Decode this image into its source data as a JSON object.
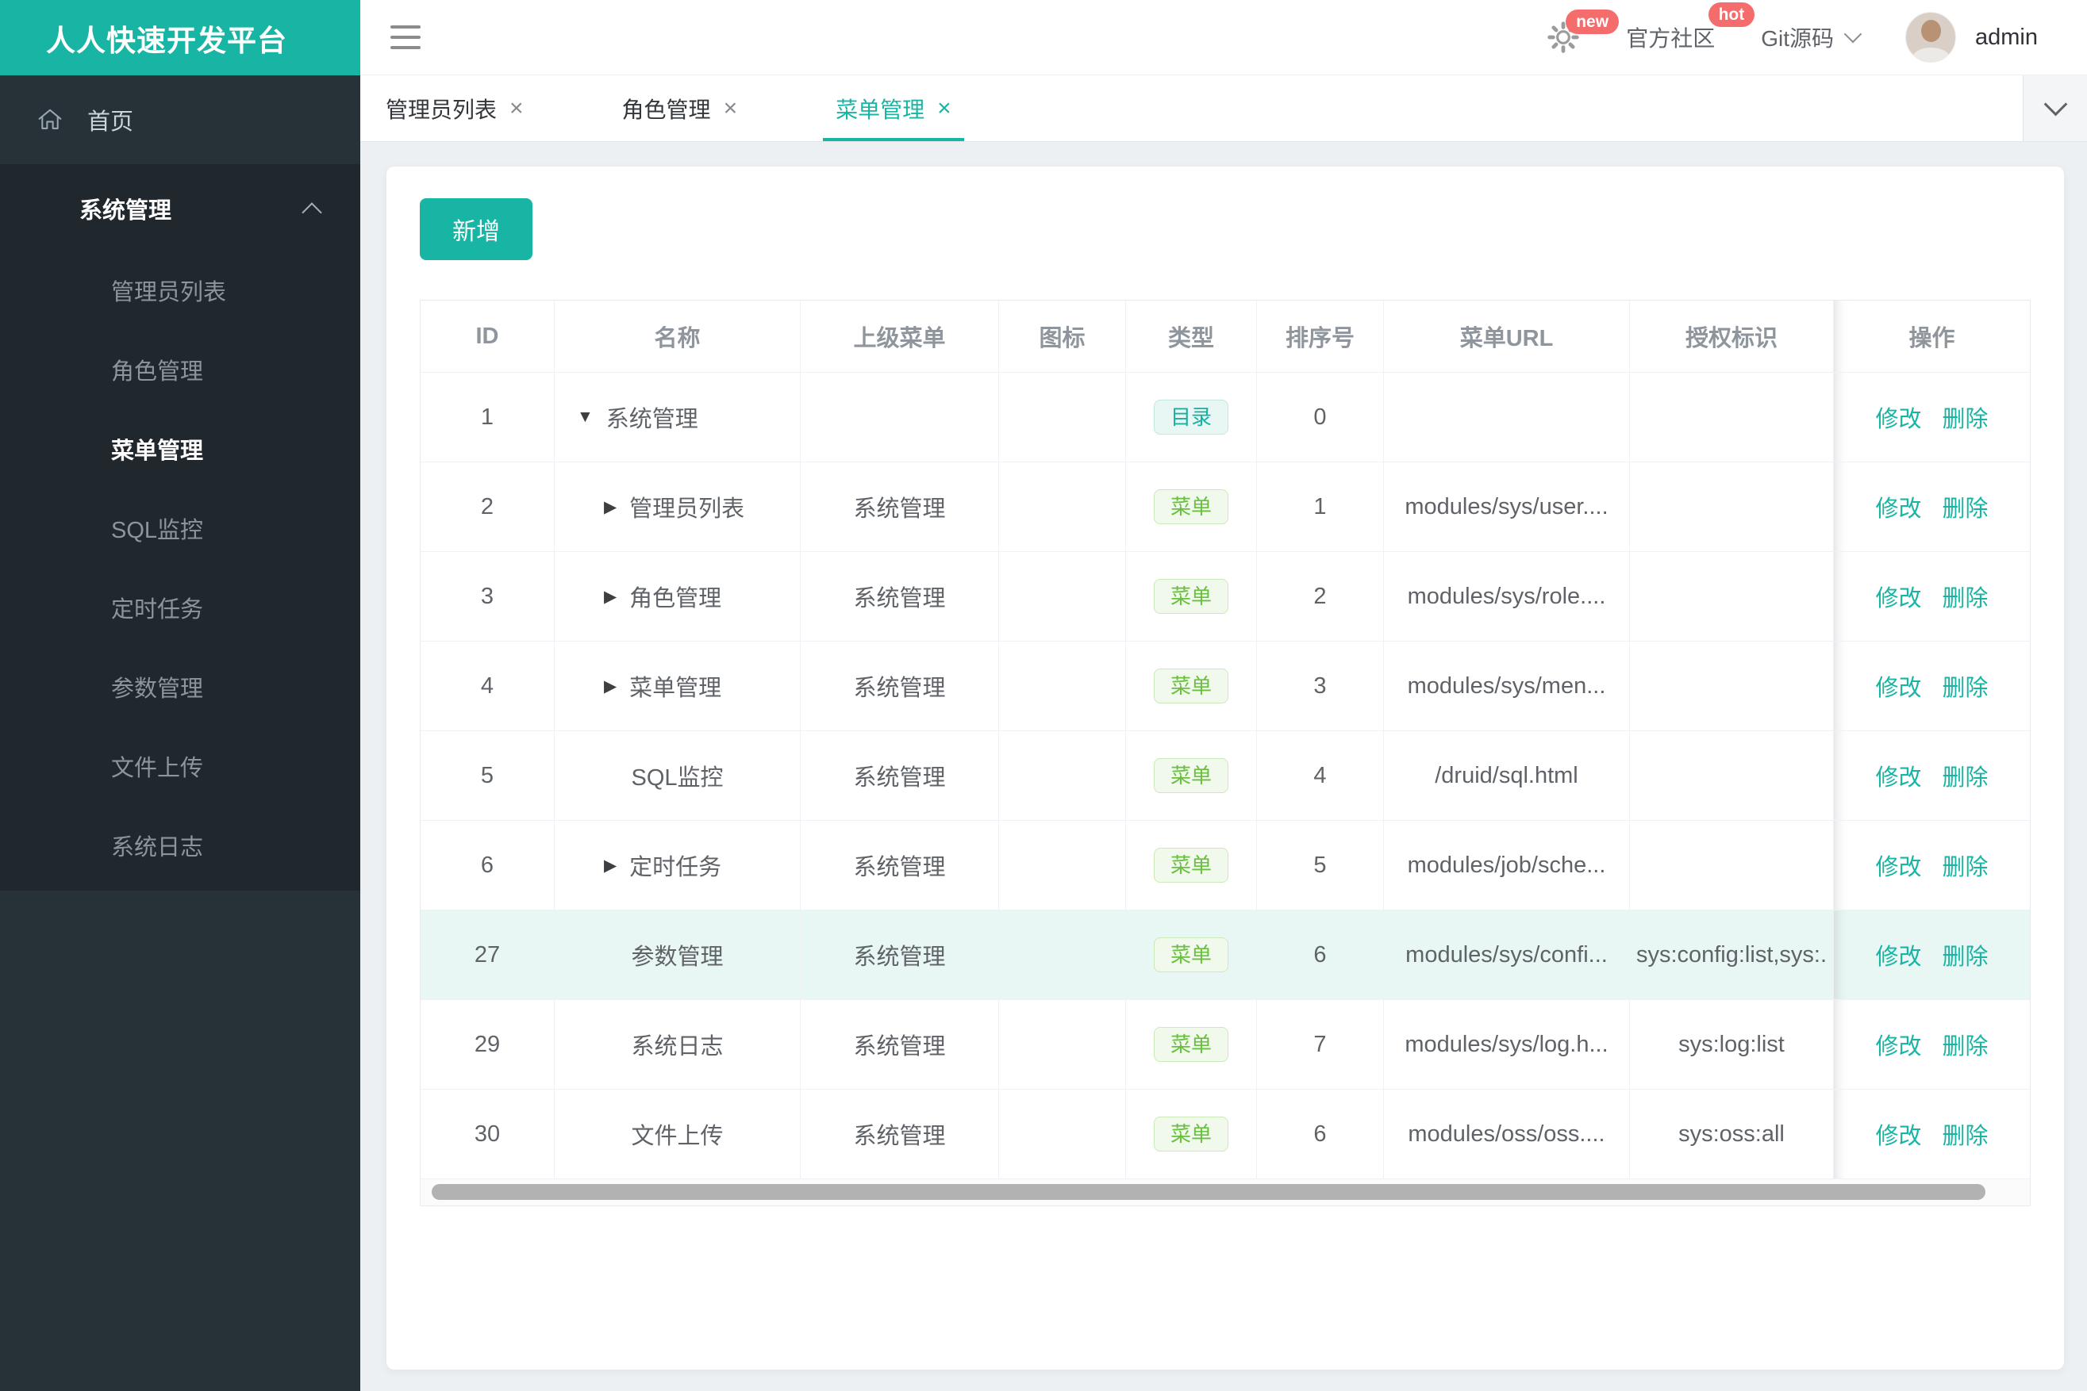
{
  "brand": {
    "title": "人人快速开发平台",
    "color": "#18b5a4"
  },
  "navbar": {
    "badge_new": "new",
    "community_label": "官方社区",
    "badge_hot": "hot",
    "git_label": "Git源码",
    "username": "admin"
  },
  "tabs": [
    {
      "label": "管理员列表",
      "active": false
    },
    {
      "label": "角色管理",
      "active": false
    },
    {
      "label": "菜单管理",
      "active": true
    }
  ],
  "sidebar": {
    "home_label": "首页",
    "group_label": "系统管理",
    "items": [
      "管理员列表",
      "角色管理",
      "菜单管理",
      "SQL监控",
      "定时任务",
      "参数管理",
      "文件上传",
      "系统日志"
    ],
    "active_item": "菜单管理"
  },
  "toolbar": {
    "add_label": "新增"
  },
  "table": {
    "columns": [
      "ID",
      "名称",
      "上级菜单",
      "图标",
      "类型",
      "排序号",
      "菜单URL",
      "授权标识",
      "操作"
    ],
    "type_badges": {
      "dir": "目录",
      "menu": "菜单"
    },
    "arrow_glyphs": {
      "down": "▼",
      "right": "▶"
    },
    "actions": {
      "edit": "修改",
      "delete": "删除"
    },
    "rows": [
      {
        "id": "1",
        "name": "系统管理",
        "arrow": "down",
        "parent": "",
        "type": "dir",
        "order": "0",
        "url": "",
        "perms": "",
        "highlight": false
      },
      {
        "id": "2",
        "name": "管理员列表",
        "arrow": "right",
        "parent": "系统管理",
        "type": "menu",
        "order": "1",
        "url": "modules/sys/user....",
        "perms": "",
        "highlight": false
      },
      {
        "id": "3",
        "name": "角色管理",
        "arrow": "right",
        "parent": "系统管理",
        "type": "menu",
        "order": "2",
        "url": "modules/sys/role....",
        "perms": "",
        "highlight": false
      },
      {
        "id": "4",
        "name": "菜单管理",
        "arrow": "right",
        "parent": "系统管理",
        "type": "menu",
        "order": "3",
        "url": "modules/sys/men...",
        "perms": "",
        "highlight": false
      },
      {
        "id": "5",
        "name": "SQL监控",
        "arrow": "none",
        "parent": "系统管理",
        "type": "menu",
        "order": "4",
        "url": "/druid/sql.html",
        "perms": "",
        "highlight": false
      },
      {
        "id": "6",
        "name": "定时任务",
        "arrow": "right",
        "parent": "系统管理",
        "type": "menu",
        "order": "5",
        "url": "modules/job/sche...",
        "perms": "",
        "highlight": false
      },
      {
        "id": "27",
        "name": "参数管理",
        "arrow": "none",
        "parent": "系统管理",
        "type": "menu",
        "order": "6",
        "url": "modules/sys/confi...",
        "perms": "sys:config:list,sys:.",
        "highlight": true
      },
      {
        "id": "29",
        "name": "系统日志",
        "arrow": "none",
        "parent": "系统管理",
        "type": "menu",
        "order": "7",
        "url": "modules/sys/log.h...",
        "perms": "sys:log:list",
        "highlight": false
      },
      {
        "id": "30",
        "name": "文件上传",
        "arrow": "none",
        "parent": "系统管理",
        "type": "menu",
        "order": "6",
        "url": "modules/oss/oss....",
        "perms": "sys:oss:all",
        "highlight": false
      }
    ]
  }
}
